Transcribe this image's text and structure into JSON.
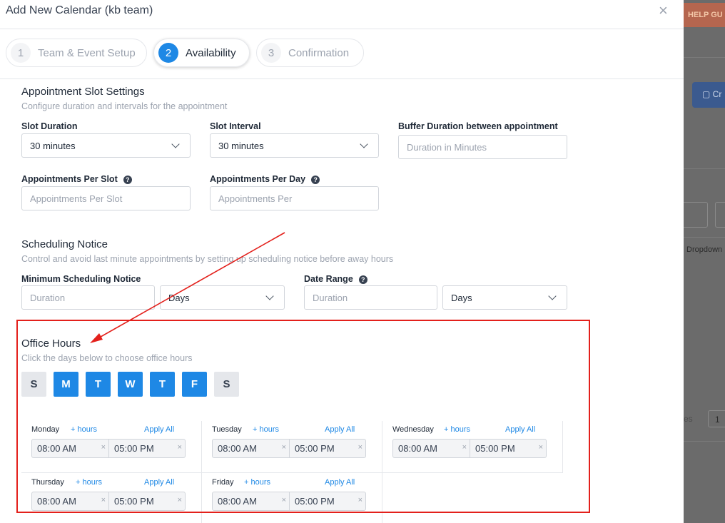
{
  "modal": {
    "title": "Add New Calendar (kb team)",
    "close": "×"
  },
  "steps": [
    {
      "num": "1",
      "label": "Team & Event Setup"
    },
    {
      "num": "2",
      "label": "Availability"
    },
    {
      "num": "3",
      "label": "Confirmation"
    }
  ],
  "slot_settings": {
    "title": "Appointment Slot Settings",
    "subtitle": "Configure duration and intervals for the appointment",
    "slot_duration": {
      "label": "Slot Duration",
      "value": "30 minutes"
    },
    "slot_interval": {
      "label": "Slot Interval",
      "value": "30 minutes"
    },
    "buffer": {
      "label": "Buffer Duration between appointment",
      "placeholder": "Duration in Minutes"
    },
    "per_slot": {
      "label": "Appointments Per Slot",
      "placeholder": "Appointments Per Slot"
    },
    "per_day": {
      "label": "Appointments Per Day",
      "placeholder": "Appointments Per"
    }
  },
  "scheduling": {
    "title": "Scheduling Notice",
    "subtitle": "Control and avoid last minute appointments by setting up scheduling notice before away hours",
    "min_notice": {
      "label": "Minimum Scheduling Notice",
      "placeholder": "Duration",
      "unit": "Days"
    },
    "date_range": {
      "label": "Date Range",
      "placeholder": "Duration",
      "unit": "Days"
    }
  },
  "office_hours": {
    "title": "Office Hours",
    "subtitle": "Click the days below to choose office hours",
    "days": [
      {
        "letter": "S",
        "active": false
      },
      {
        "letter": "M",
        "active": true
      },
      {
        "letter": "T",
        "active": true
      },
      {
        "letter": "W",
        "active": true
      },
      {
        "letter": "T",
        "active": true
      },
      {
        "letter": "F",
        "active": true
      },
      {
        "letter": "S",
        "active": false
      }
    ],
    "add_hours_label": "+ hours",
    "apply_all_label": "Apply All",
    "schedule": [
      {
        "day": "Monday",
        "start": "08:00 AM",
        "end": "05:00 PM"
      },
      {
        "day": "Tuesday",
        "start": "08:00 AM",
        "end": "05:00 PM"
      },
      {
        "day": "Wednesday",
        "start": "08:00 AM",
        "end": "05:00 PM"
      },
      {
        "day": "Thursday",
        "start": "08:00 AM",
        "end": "05:00 PM"
      },
      {
        "day": "Friday",
        "start": "08:00 AM",
        "end": "05:00 PM"
      }
    ]
  },
  "background": {
    "help_text": "HELP GU",
    "button_text": "Cr",
    "dropdown_text": "Dropdown",
    "side_text": "es",
    "page_num": "1"
  },
  "colors": {
    "accent": "#1e88e5",
    "annotation": "#e3201b"
  }
}
